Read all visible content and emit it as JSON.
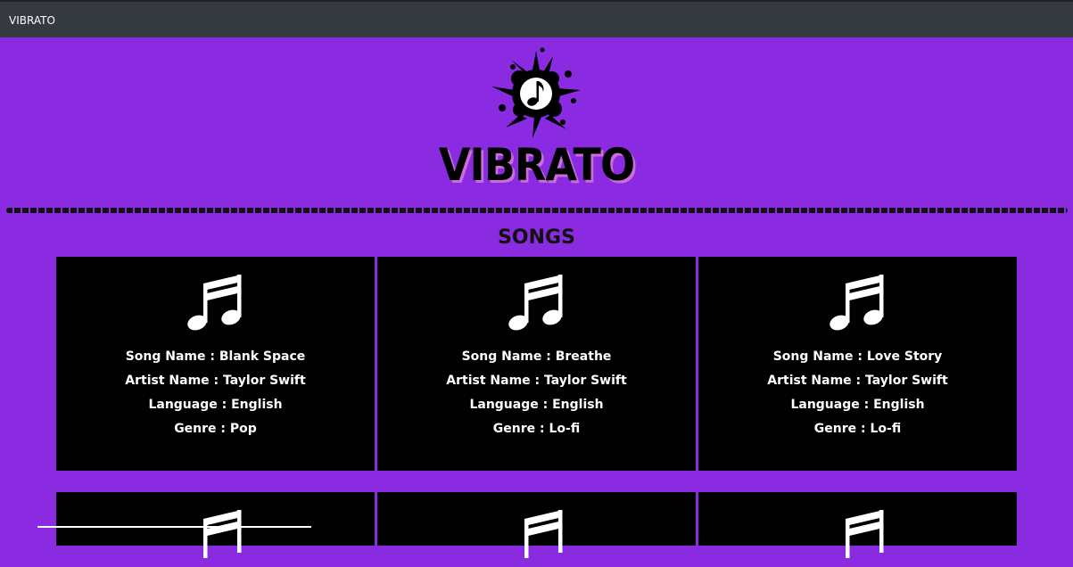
{
  "window": {
    "title": "VIBRATO"
  },
  "header": {
    "brand": "VIBRATO"
  },
  "section": {
    "title": "SONGS"
  },
  "songs": [
    {
      "song": "Song Name : Blank Space",
      "artist": "Artist Name : Taylor Swift",
      "language": "Language : English",
      "genre": "Genre : Pop"
    },
    {
      "song": "Song Name : Breathe",
      "artist": "Artist Name : Taylor Swift",
      "language": "Language : English",
      "genre": "Genre : Lo-fi"
    },
    {
      "song": "Song Name : Love Story",
      "artist": "Artist Name : Taylor Swift",
      "language": "Language : English",
      "genre": "Genre : Lo-fi"
    }
  ],
  "colors": {
    "background": "#8a2be2",
    "titlebar": "#343a40",
    "card": "#000000",
    "text": "#ffffff"
  },
  "icons": {
    "logo": "music-splash-logo-icon",
    "card": "music-note-icon"
  }
}
